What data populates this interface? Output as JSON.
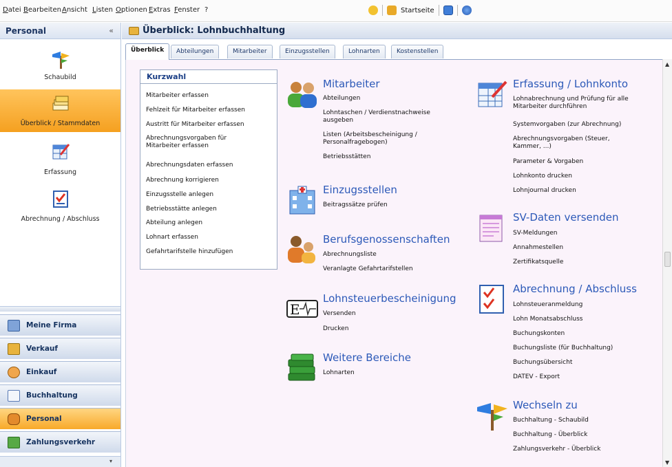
{
  "menubar": {
    "items": [
      "Datei",
      "Bearbeiten",
      "Ansicht",
      "Listen",
      "Optionen",
      "Extras",
      "Fenster",
      "?"
    ],
    "toolbar_start_label": "Startseite"
  },
  "nav": {
    "title": "Personal",
    "collapse": "«",
    "entries": [
      "Schaubild",
      "Überblick / Stammdaten",
      "Erfassung",
      "Abrechnung / Abschluss"
    ],
    "modules": [
      "Meine Firma",
      "Verkauf",
      "Einkauf",
      "Buchhaltung",
      "Personal",
      "Zahlungsverkehr"
    ],
    "footer": "▾"
  },
  "main": {
    "title": "Überblick: Lohnbuchhaltung",
    "tabs": [
      "Überblick",
      "Abteilungen",
      "Mitarbeiter",
      "Einzugsstellen",
      "Lohnarten",
      "Kostenstellen"
    ]
  },
  "kurzwahl": {
    "title": "Kurzwahl",
    "items": [
      "Mitarbeiter erfassen",
      "Fehlzeit für Mitarbeiter erfassen",
      "Austritt für Mitarbeiter erfassen",
      "Abrechnungsvorgaben für Mitarbeiter erfassen",
      "Abrechnungsdaten erfassen",
      "Abrechnung korrigieren",
      "Einzugsstelle anlegen",
      "Betriebsstätte anlegen",
      "Abteilung anlegen",
      "Lohnart erfassen",
      "Gefahrtarifstelle hinzufügen"
    ]
  },
  "sections": {
    "mitarbeiter": {
      "title": "Mitarbeiter",
      "links": [
        "Abteilungen",
        "Lohntaschen / Verdienstnachweise ausgeben",
        "Listen (Arbeitsbescheinigung / Personalfragebogen)",
        "Betriebsstätten"
      ]
    },
    "einzugsstellen": {
      "title": "Einzugsstellen",
      "links": [
        "Beitragssätze prüfen"
      ]
    },
    "berufsgenossenschaften": {
      "title": "Berufsgenossenschaften",
      "links": [
        "Abrechnungsliste",
        "Veranlagte Gefahrtarifstellen"
      ]
    },
    "lohnsteuer": {
      "title": "Lohnsteuerbescheinigung",
      "links": [
        "Versenden",
        "Drucken"
      ]
    },
    "weitere": {
      "title": "Weitere Bereiche",
      "links": [
        "Lohnarten"
      ]
    },
    "erfassung": {
      "title": "Erfassung / Lohnkonto",
      "links": [
        "Lohnabrechnung und Prüfung für alle Mitarbeiter durchführen",
        "Systemvorgaben (zur Abrechnung)",
        "Abrechnungsvorgaben (Steuer, Kammer, ...)",
        "Parameter & Vorgaben",
        "Lohnkonto drucken",
        "Lohnjournal drucken"
      ]
    },
    "sv": {
      "title": "SV-Daten versenden",
      "links": [
        "SV-Meldungen",
        "Annahmestellen",
        "Zertifikatsquelle"
      ]
    },
    "abrechnung": {
      "title": "Abrechnung / Abschluss",
      "links": [
        "Lohnsteueranmeldung",
        "Lohn Monatsabschluss",
        "Buchungskonten",
        "Buchungsliste (für Buchhaltung)",
        "Buchungsübersicht",
        "DATEV - Export"
      ]
    },
    "wechseln": {
      "title": "Wechseln zu",
      "links": [
        "Buchhaltung - Schaubild",
        "Buchhaltung - Überblick",
        "Zahlungsverkehr - Überblick"
      ]
    }
  },
  "colors": {
    "accent": "#2c59b8",
    "active_orange": "#f5a020",
    "content_bg": "#fbf3fb"
  }
}
